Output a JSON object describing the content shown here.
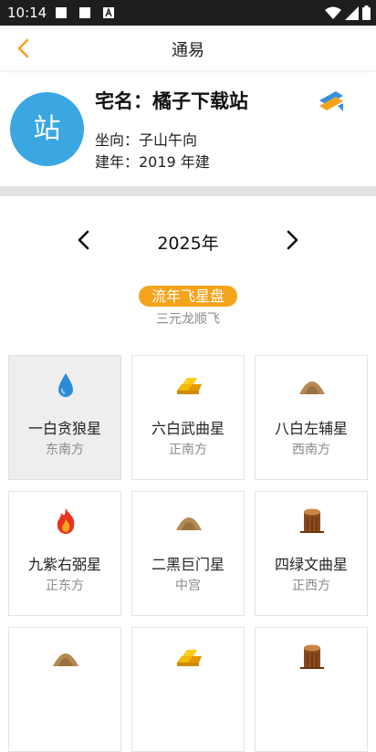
{
  "status": {
    "time": "10:14"
  },
  "nav": {
    "title": "通易"
  },
  "house": {
    "avatar_char": "站",
    "name": "宅名：橘子下载站",
    "orientation": "坐向：子山午向",
    "built": "建年：2019 年建"
  },
  "year": {
    "label": "2025年"
  },
  "board": {
    "badge": "流年飞星盘",
    "subtitle": "三元龙顺飞"
  },
  "stars": [
    {
      "name": "一白贪狼星",
      "direction": "东南方",
      "icon": "water-drop-icon",
      "selected": true
    },
    {
      "name": "六白武曲星",
      "direction": "正南方",
      "icon": "gold-bars-icon",
      "selected": false
    },
    {
      "name": "八白左辅星",
      "direction": "西南方",
      "icon": "earth-mound-icon",
      "selected": false
    },
    {
      "name": "九紫右弼星",
      "direction": "正东方",
      "icon": "fire-icon",
      "selected": false
    },
    {
      "name": "二黑巨门星",
      "direction": "中宫",
      "icon": "earth-mound-icon",
      "selected": false
    },
    {
      "name": "四绿文曲星",
      "direction": "正西方",
      "icon": "wood-stump-icon",
      "selected": false
    },
    {
      "name": "",
      "direction": "",
      "icon": "earth-mound-icon",
      "selected": false
    },
    {
      "name": "",
      "direction": "",
      "icon": "gold-bars-icon",
      "selected": false
    },
    {
      "name": "",
      "direction": "",
      "icon": "wood-stump-icon",
      "selected": false
    }
  ],
  "colors": {
    "accent": "#f5a31a",
    "avatar": "#3aa7e2",
    "statusbar": "#1e1e1e"
  }
}
